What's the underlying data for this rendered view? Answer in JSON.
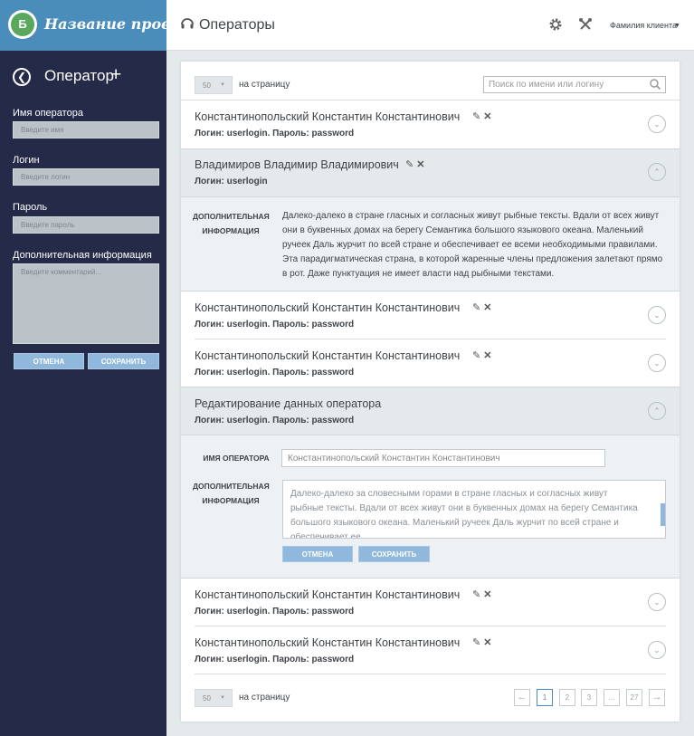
{
  "brand": {
    "name": "Название проекта",
    "logo_letter": "Б"
  },
  "sidebar": {
    "title": "Оператор",
    "fields": [
      {
        "label": "Имя оператора",
        "placeholder": "Введите имя"
      },
      {
        "label": "Логин",
        "placeholder": "Введите логин"
      },
      {
        "label": "Пароль",
        "placeholder": "Введите пароль"
      },
      {
        "label": "Дополнительная информация",
        "placeholder": "Введите комментарий..."
      }
    ],
    "cancel": "ОТМЕНА",
    "save": "СОХРАНИТЬ"
  },
  "header": {
    "title": "Операторы",
    "client": "Фамилия клиента"
  },
  "list": {
    "per_page_value": "50",
    "per_page_label": "на страницу",
    "search_placeholder": "Поиск по имени или логину",
    "rows": [
      {
        "name": "Константинопольский Константин Константинович",
        "login": "Логин: userlogin. Пароль: password"
      },
      {
        "name": "Владимиров Владимир Владимирович",
        "login": "Логин: userlogin"
      },
      {
        "name": "Константинопольский Константин Константинович",
        "login": "Логин: userlogin. Пароль: password"
      },
      {
        "name": "Константинопольский Константин Константинович",
        "login": "Логин: userlogin. Пароль: password"
      },
      {
        "name": "Редактирование данных оператора",
        "login": "Логин: userlogin. Пароль: password"
      },
      {
        "name": "Константинопольский Константин Константинович",
        "login": "Логин: userlogin. Пароль: password"
      },
      {
        "name": "Константинопольский Константин Константинович",
        "login": "Логин: userlogin. Пароль: password"
      }
    ],
    "expanded": {
      "label_line1": "ДОПОЛНИТЕЛЬНАЯ",
      "label_line2": "ИНФОРМАЦИЯ",
      "text": "Далеко-далеко в стране гласных и согласных живут рыбные тексты. Вдали от всех живут они в буквенных домах на берегу Семантика большого языкового океана. Маленький ручеек Даль журчит по всей стране и обеспечивает ее всеми необходимыми правилами. Эта парадигматическая страна, в которой жаренные члены предложения залетают прямо в рот. Даже пунктуация не имеет власти над рыбными текстами."
    },
    "edit": {
      "name_label": "ИМЯ ОПЕРАТОРА",
      "name_value": "Константинопольский Константин Константинович",
      "info_label1": "ДОПОЛНИТЕЛЬНАЯ",
      "info_label2": "ИНФОРМАЦИЯ",
      "info_value": "Далеко-далеко за словесными горами в стране гласных и согласных живут рыбные тексты. Вдали от всех живут они в буквенных домах на берегу Семантика большого языкового океана. Маленький ручеек Даль журчит по всей стране и обеспечивает ее",
      "cancel": "ОТМЕНА",
      "save": "СОХРАНИТЬ"
    },
    "pagination": {
      "pages": [
        "1",
        "2",
        "3",
        "...",
        "27"
      ],
      "current": "1"
    }
  },
  "colors": {
    "sidebar": "#262a49",
    "brand": "#4a8dba",
    "accent": "#8fb8dc"
  }
}
